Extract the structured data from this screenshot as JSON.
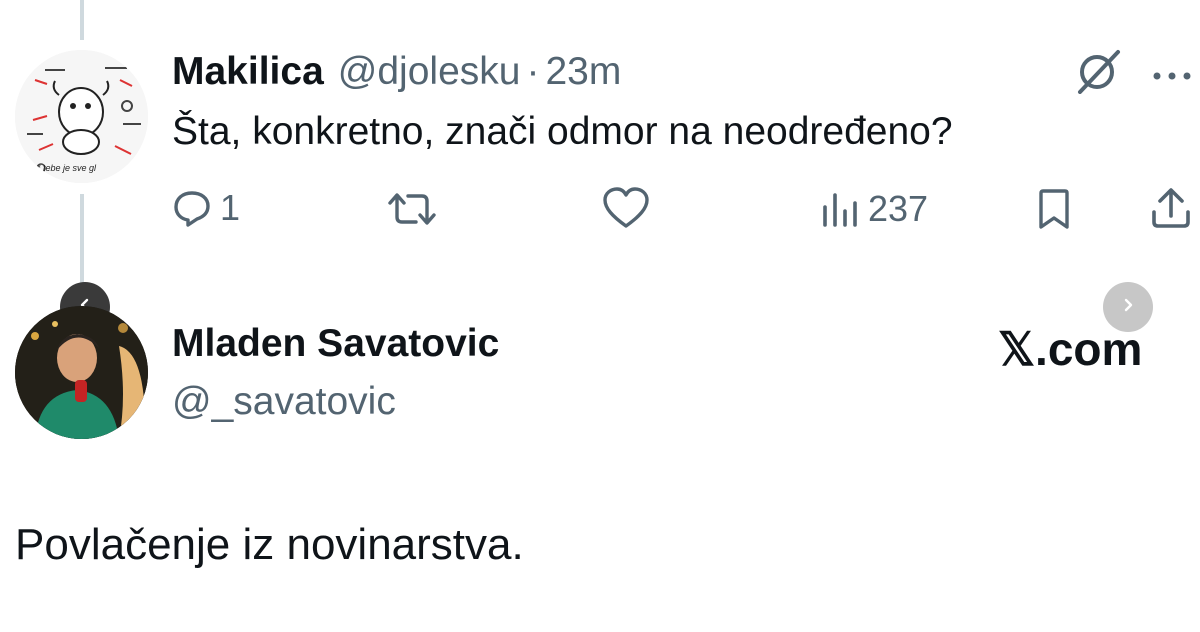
{
  "reply_tweet": {
    "display_name": "Makilica",
    "handle": "@djolesku",
    "separator": "·",
    "time": "23m",
    "text": "Šta, konkretno, znači odmor na neodređeno?",
    "avatar_caption": "* tebe je sve gl",
    "actions": {
      "reply_count": "1",
      "views_count": "237"
    }
  },
  "main_tweet": {
    "display_name": "Mladen Savatovic",
    "handle": "@_savatovic",
    "text": "Povlačenje iz novinarstva.",
    "brand": "𝕏.com"
  },
  "colors": {
    "text": "#0f1419",
    "muted": "#536471",
    "thread_line": "#cfd9de",
    "nav_button_dark": "#3a3a3a",
    "nav_button_light": "#c7c7c7"
  }
}
